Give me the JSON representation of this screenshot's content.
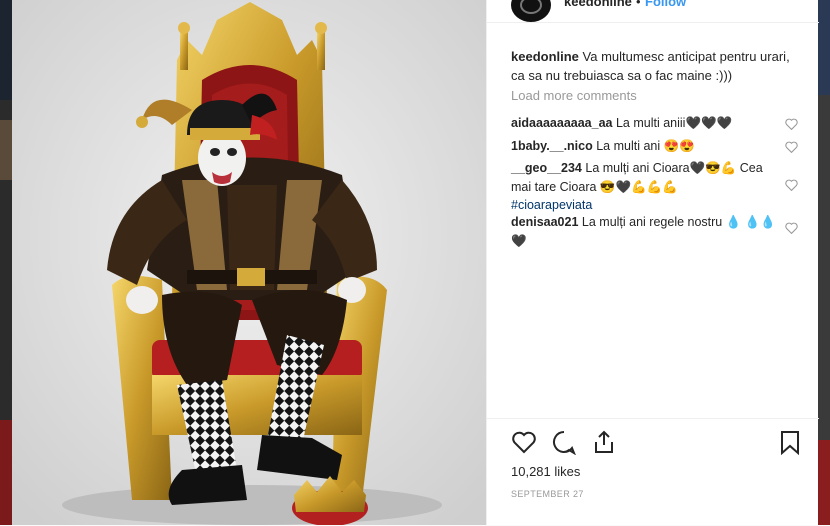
{
  "post": {
    "username": "keedonline",
    "separator": "•",
    "follow_label": "Follow"
  },
  "caption": {
    "username": "keedonline",
    "text": "Va multumesc anticipat pentru urari, ca sa nu trebuiasca sa o fac maine :)))"
  },
  "load_more_label": "Load more comments",
  "comments": [
    {
      "username": "aidaaaaaaaaa_aa",
      "text": "La multi aniii🖤🖤🖤"
    },
    {
      "username": "1baby.__.nico",
      "text": "La multi ani 😍😍"
    },
    {
      "username": "__geo__234",
      "text": "La mulți ani Cioara🖤😎💪 Cea mai tare Cioara 😎🖤💪💪💪"
    },
    {
      "hashtag": "#cioarapeviata"
    },
    {
      "username": "denisaa021",
      "text": "La mulți ani regele nostru 💧 💧💧🖤"
    }
  ],
  "likes": "10,281 likes",
  "date": "SEPTEMBER 27",
  "icons": {
    "like": "heart-icon",
    "comment": "comment-icon",
    "share": "share-icon",
    "save": "bookmark-icon",
    "comment_like": "heart-outline-icon"
  },
  "colors": {
    "link": "#3897f0",
    "text": "#262626",
    "muted": "#999999",
    "hashtag": "#003569"
  }
}
